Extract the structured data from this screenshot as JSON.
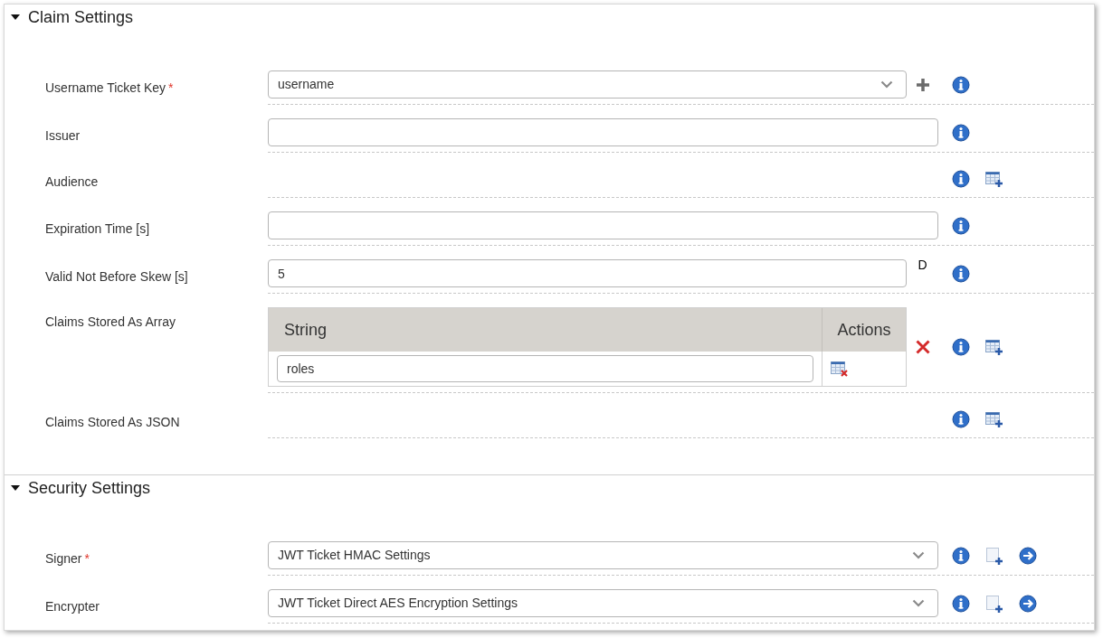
{
  "sections": [
    {
      "title": "Claim Settings",
      "expanded": true,
      "rows": [
        {
          "label": "Username Ticket Key",
          "required_mark": "*",
          "kind": "select",
          "value": "username",
          "extra": {
            "kind": "plus"
          },
          "icons": [
            {
              "kind": "info"
            }
          ]
        },
        {
          "label": "Issuer",
          "kind": "text",
          "value": "",
          "icons": [
            {
              "kind": "info"
            }
          ]
        },
        {
          "label": "Audience",
          "kind": "none",
          "icons": [
            {
              "kind": "info"
            },
            {
              "kind": "add-table"
            }
          ]
        },
        {
          "label": "Expiration Time [s]",
          "kind": "text",
          "value": "",
          "icons": [
            {
              "kind": "info"
            }
          ]
        },
        {
          "label": "Valid Not Before Skew [s]",
          "kind": "text",
          "value": "5",
          "extra": {
            "kind": "note",
            "text": "D"
          },
          "icons": [
            {
              "kind": "info"
            }
          ]
        },
        {
          "label": "Claims Stored As Array",
          "kind": "table",
          "columns": [
            "String",
            "Actions"
          ],
          "rows": [
            {
              "value": "roles"
            }
          ],
          "extra": {
            "kind": "delete"
          },
          "icons": [
            {
              "kind": "info"
            },
            {
              "kind": "add-table"
            }
          ]
        },
        {
          "label": "Claims Stored As JSON",
          "kind": "none",
          "icons": [
            {
              "kind": "info"
            },
            {
              "kind": "add-table"
            }
          ]
        }
      ]
    },
    {
      "title": "Security Settings",
      "expanded": true,
      "rows": [
        {
          "label": "Signer",
          "required_mark": "*",
          "kind": "select",
          "value": "JWT Ticket HMAC Settings",
          "icons": [
            {
              "kind": "info"
            },
            {
              "kind": "new"
            },
            {
              "kind": "go"
            }
          ]
        },
        {
          "label": "Encrypter",
          "kind": "select",
          "value": "JWT Ticket Direct AES Encryption Settings",
          "icons": [
            {
              "kind": "info"
            },
            {
              "kind": "new"
            },
            {
              "kind": "go"
            }
          ]
        }
      ]
    }
  ]
}
